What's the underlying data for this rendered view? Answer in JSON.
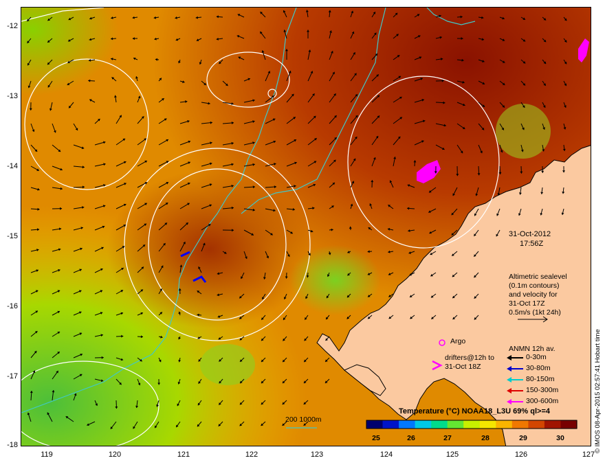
{
  "map": {
    "lon_ticks": [
      "119",
      "120",
      "121",
      "122",
      "123",
      "124",
      "125",
      "126",
      "127"
    ],
    "lat_ticks": [
      "-12",
      "-13",
      "-14",
      "-15",
      "-16",
      "-17",
      "-18"
    ],
    "extent": {
      "lon_min": 118.6,
      "lon_max": 127.0,
      "lat_min": -18.0,
      "lat_max": -11.7
    }
  },
  "annotations": {
    "date": "31-Oct-2012",
    "time": "17:56Z",
    "altimetry_lines": [
      "Altimetric sealevel",
      "(0.1m contours)",
      "and velocity for",
      "31-Oct 17Z",
      "0.5m/s (1kt 24h)"
    ],
    "argo_label": "Argo",
    "drifters_lines": [
      "drifters@12h to",
      "31-Oct 18Z"
    ],
    "depth_contour_label": "200  1000m"
  },
  "anmn_legend": {
    "title": "ANMN 12h av.",
    "items": [
      {
        "label": "0-30m",
        "color": "#000000"
      },
      {
        "label": "30-80m",
        "color": "#0000cc"
      },
      {
        "label": "80-150m",
        "color": "#00cccc"
      },
      {
        "label": "150-300m",
        "color": "#dd0000"
      },
      {
        "label": "300-600m",
        "color": "#ff00ff"
      }
    ]
  },
  "colorbar": {
    "title": "Temperature (°C) NOAA18_L3U 69% ql>=4",
    "ticks": [
      "25",
      "26",
      "27",
      "28",
      "29",
      "30"
    ],
    "colors": [
      "#00006e",
      "#0014c8",
      "#0078ff",
      "#00c8e6",
      "#00dc8c",
      "#64e632",
      "#c8f000",
      "#f5e600",
      "#fab400",
      "#f07800",
      "#d24600",
      "#a01400",
      "#780000"
    ]
  },
  "credit": "© IMOS 08-Apr-2015 02:57:41 Hobart time",
  "colors": {
    "land": "#fbc9a0",
    "sst_cool": "#6ec83c",
    "sst_mid": "#f0a000",
    "sst_warm": "#c04800",
    "sst_hot": "#8a1200",
    "sealevel_contour": "#ffffff",
    "isobath": "#40c8c8"
  },
  "ssh_contours_count": 8,
  "velocity_arrow_count": 400
}
